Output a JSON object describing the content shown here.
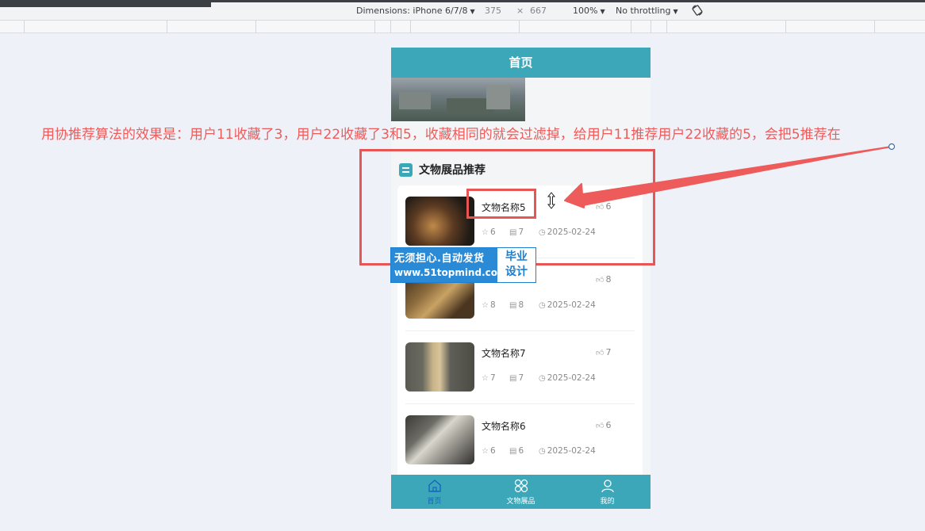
{
  "devtools": {
    "dimensions_label": "Dimensions: iPhone 6/7/8",
    "width": "375",
    "times": "×",
    "height": "667",
    "zoom": "100%",
    "throttling": "No throttling",
    "rotate_icon": "rotate-icon"
  },
  "app": {
    "title": "首页",
    "section_title": "文物展品推荐",
    "items": [
      {
        "name": "文物名称5",
        "likes": "6",
        "favorites": "6",
        "views": "7",
        "date": "2025-02-24"
      },
      {
        "name": "",
        "likes": "8",
        "favorites": "8",
        "views": "8",
        "date": "2025-02-24"
      },
      {
        "name": "文物名称7",
        "likes": "7",
        "favorites": "7",
        "views": "7",
        "date": "2025-02-24"
      },
      {
        "name": "文物名称6",
        "likes": "6",
        "favorites": "6",
        "views": "6",
        "date": "2025-02-24"
      }
    ],
    "tabs": [
      {
        "label": "首页",
        "icon": "home-icon",
        "active": true
      },
      {
        "label": "文物展品",
        "icon": "grid-icon",
        "active": false
      },
      {
        "label": "我的",
        "icon": "user-icon",
        "active": false
      }
    ],
    "colors": {
      "primary": "#3ba7b9",
      "annotation": "#ee5b5b",
      "watermark": "#2b8ad6"
    }
  },
  "annotation": {
    "text": "用协推荐算法的效果是：用户11收藏了3，用户22收藏了3和5，收藏相同的就会过滤掉，给用户11推荐用户22收藏的5，会把5推荐在"
  },
  "watermark": {
    "line1": "无须担心.自动发货",
    "line2": "www.51topmind.com",
    "right_line1": "毕业",
    "right_line2": "设计"
  }
}
